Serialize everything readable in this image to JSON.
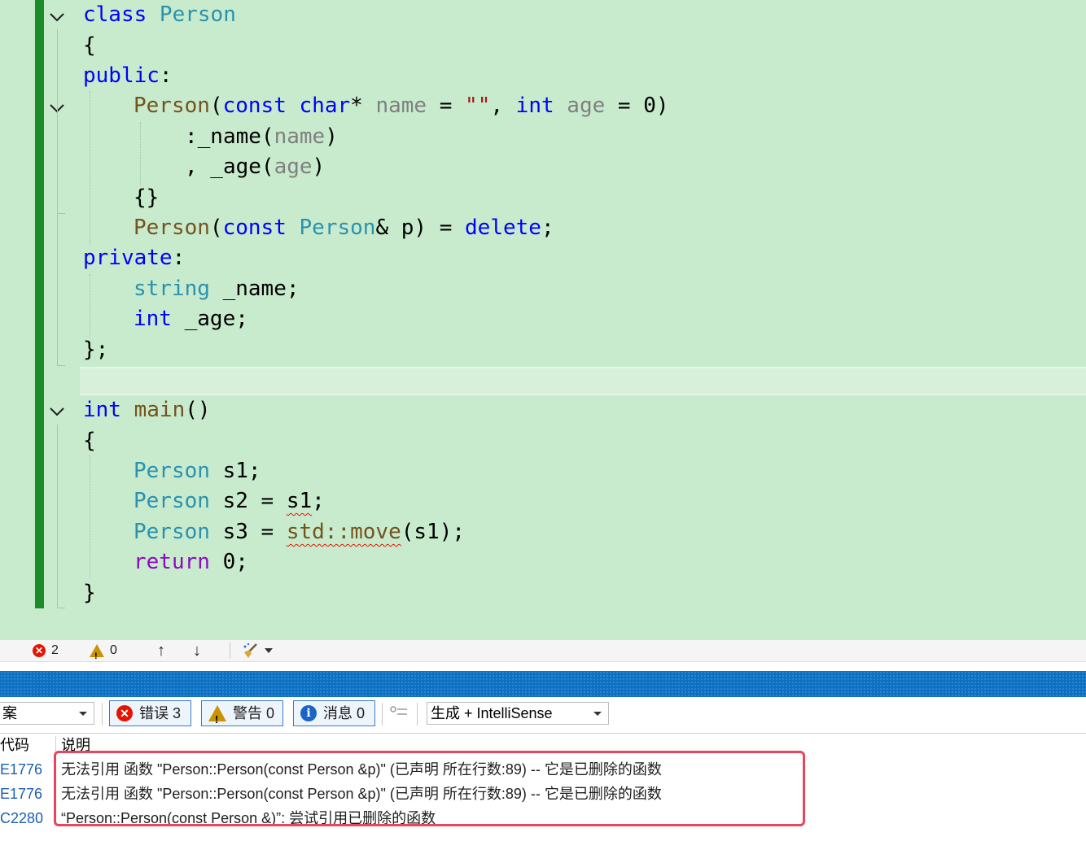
{
  "editor": {
    "lines": [
      [
        "class ",
        "Person"
      ],
      [
        "{"
      ],
      [
        "public",
        ":"
      ],
      [
        "Person",
        "(",
        "const",
        " ",
        "char",
        "* ",
        "name",
        " = ",
        "\"\"",
        ", ",
        "int",
        " ",
        "age",
        " = ",
        "0",
        ")"
      ],
      [
        ":_name(",
        "name",
        ")"
      ],
      [
        ", _age(",
        "age",
        ")"
      ],
      [
        "{}"
      ],
      [
        "Person",
        "(",
        "const",
        " ",
        "Person",
        "& p) = ",
        "delete",
        ";"
      ],
      [
        "private",
        ":"
      ],
      [
        "string",
        " _name;"
      ],
      [
        "int",
        " _age;"
      ],
      [
        "};"
      ],
      [
        ""
      ],
      [
        "int",
        " ",
        "main",
        "()"
      ],
      [
        "{"
      ],
      [
        "Person",
        " s1;"
      ],
      [
        "Person",
        " s2 = ",
        "s1",
        ";"
      ],
      [
        "Person",
        " s3 = ",
        "std::move",
        "(s1);"
      ],
      [
        "return",
        " 0;"
      ],
      [
        "}"
      ]
    ]
  },
  "statusbar": {
    "errors": "2",
    "warnings": "0",
    "up_arrow": "↑",
    "down_arrow": "↓"
  },
  "error_list": {
    "scope_value": "案",
    "errors_label": "错误 3",
    "warnings_label": "警告 0",
    "messages_label": "消息 0",
    "source_filter": "生成 + IntelliSense",
    "columns": {
      "code": "代码",
      "description": "说明"
    },
    "rows": [
      {
        "code": "E1776",
        "description": "无法引用 函数 \"Person::Person(const Person &p)\" (已声明 所在行数:89) -- 它是已删除的函数"
      },
      {
        "code": "E1776",
        "description": "无法引用 函数 \"Person::Person(const Person &p)\" (已声明 所在行数:89) -- 它是已删除的函数"
      },
      {
        "code": "C2280",
        "description": "“Person::Person(const Person &)”: 尝试引用已删除的函数"
      }
    ]
  },
  "colors": {
    "editor_bg": "#c7ebcc",
    "change_bar": "#1f8a2a",
    "keyword": "#0000ff",
    "type": "#2b91af",
    "function": "#74531f",
    "highlight_box": "#e8455c"
  }
}
